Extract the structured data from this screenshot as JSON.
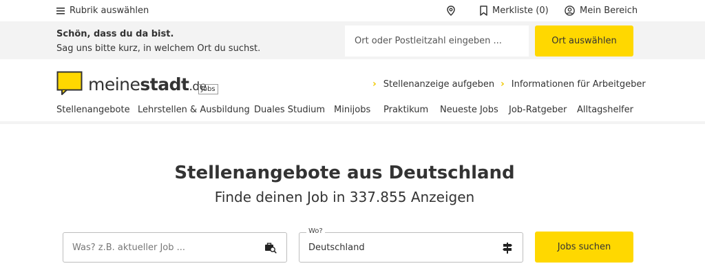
{
  "topbar": {
    "rubrik_label": "Rubrik auswählen",
    "merkliste_label": "Merkliste (0)",
    "mein_bereich_label": "Mein Bereich"
  },
  "location_prompt": {
    "title": "Schön, dass du da bist.",
    "subtitle": "Sag uns bitte kurz, in welchem Ort du suchst.",
    "input_placeholder": "Ort oder Postleitzahl eingeben ...",
    "button_label": "Ort auswählen"
  },
  "header": {
    "logo_word_1": "meine",
    "logo_word_2": "stadt",
    "logo_tld": ".de",
    "logo_badge": "Jobs",
    "links": [
      "Stellenanzeige aufgeben",
      "Informationen für Arbeitgeber"
    ]
  },
  "nav": {
    "items": [
      "Stellenangebote",
      "Lehrstellen & Ausbildung",
      "Duales Studium",
      "Minijobs",
      "Praktikum",
      "Neueste Jobs",
      "Job-Ratgeber",
      "Alltagshelfer"
    ],
    "active_index": 0
  },
  "hero": {
    "title": "Stellenangebote aus Deutschland",
    "subtitle": "Finde deinen Job in 337.855 Anzeigen"
  },
  "search": {
    "what_placeholder": "Was? z.B. aktueller Job ...",
    "where_label": "Wo?",
    "where_value": "Deutschland",
    "button_label": "Jobs suchen"
  },
  "colors": {
    "accent": "#ffd800",
    "band_bg": "#f3f3f3",
    "text": "#333333"
  },
  "icons": [
    "hamburger-menu-icon",
    "location-pin-icon",
    "bookmark-icon",
    "user-circle-icon",
    "speech-bubble-logo-icon",
    "chevron-right-icon",
    "briefcase-search-icon",
    "signpost-icon"
  ]
}
